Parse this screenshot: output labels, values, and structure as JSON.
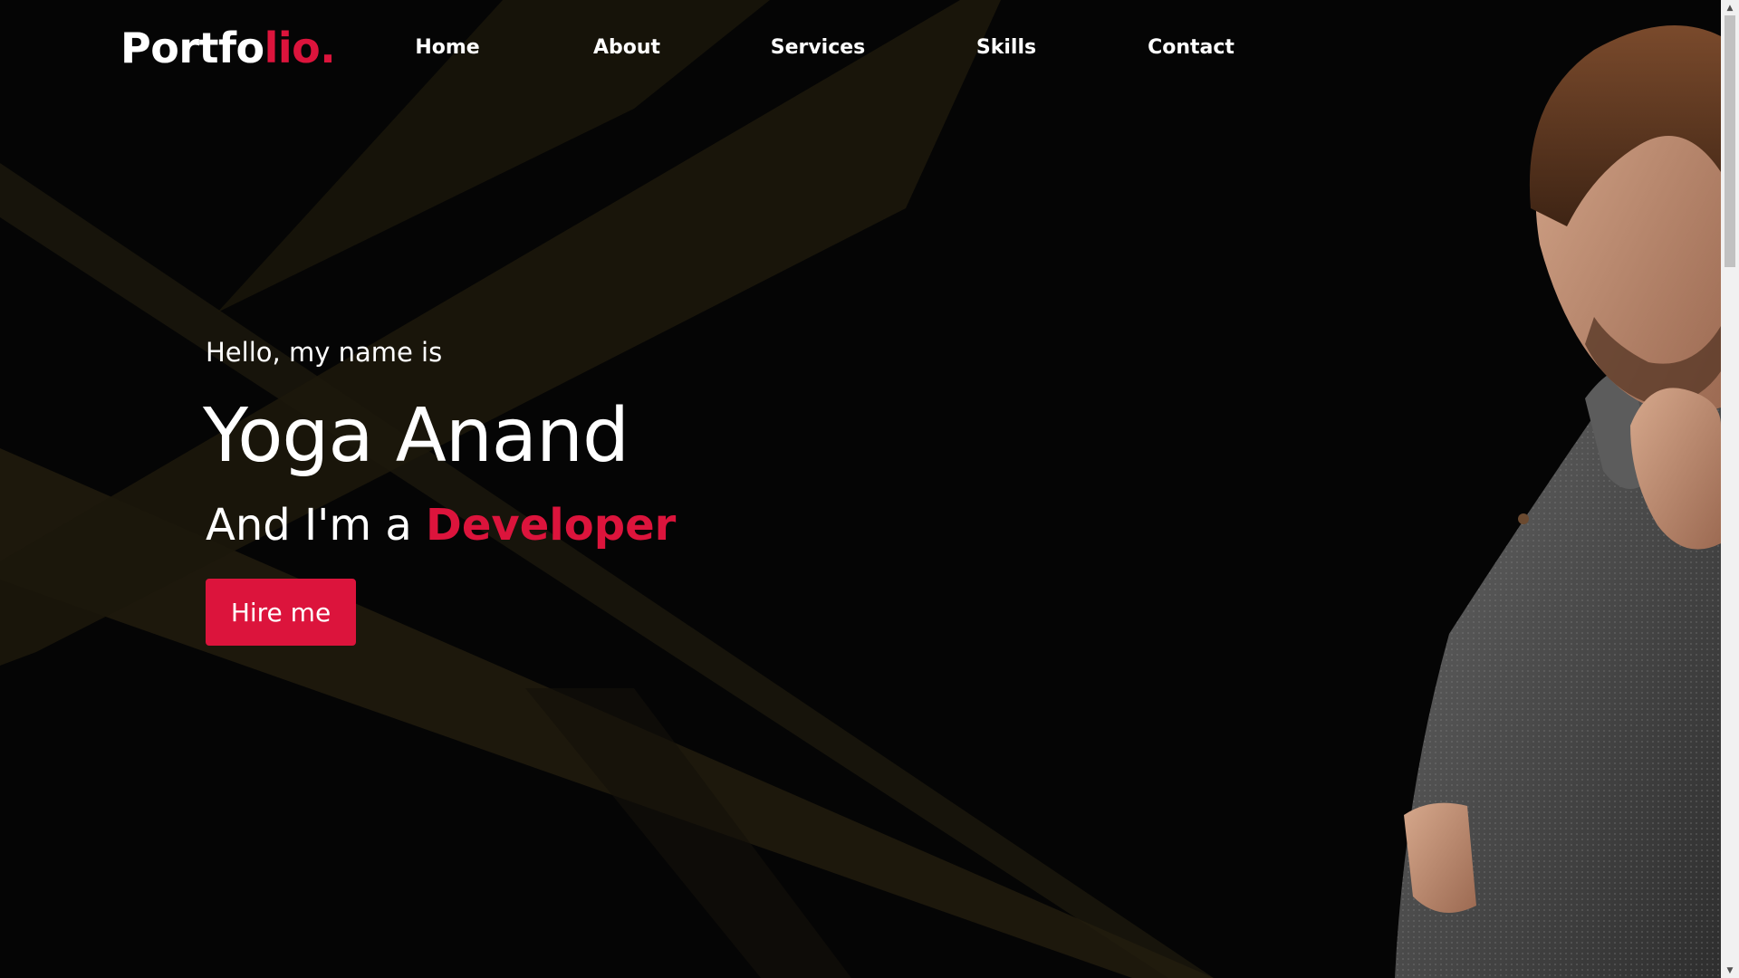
{
  "logo": {
    "main": "Portfo",
    "accent": "lio."
  },
  "nav": {
    "items": [
      {
        "label": "Home"
      },
      {
        "label": "About"
      },
      {
        "label": "Services"
      },
      {
        "label": "Skills"
      },
      {
        "label": "Contact"
      }
    ]
  },
  "hero": {
    "greeting": "Hello, my name is",
    "name": "Yoga Anand",
    "role_prefix": "And I'm a",
    "role": "Developer",
    "cta": "Hire me"
  },
  "colors": {
    "accent": "#dc143c",
    "background": "#050505",
    "text": "#ffffff",
    "ray": "#2a2210"
  },
  "icons": {
    "scroll_up": "triangle-up-icon",
    "scroll_down": "triangle-down-icon"
  }
}
